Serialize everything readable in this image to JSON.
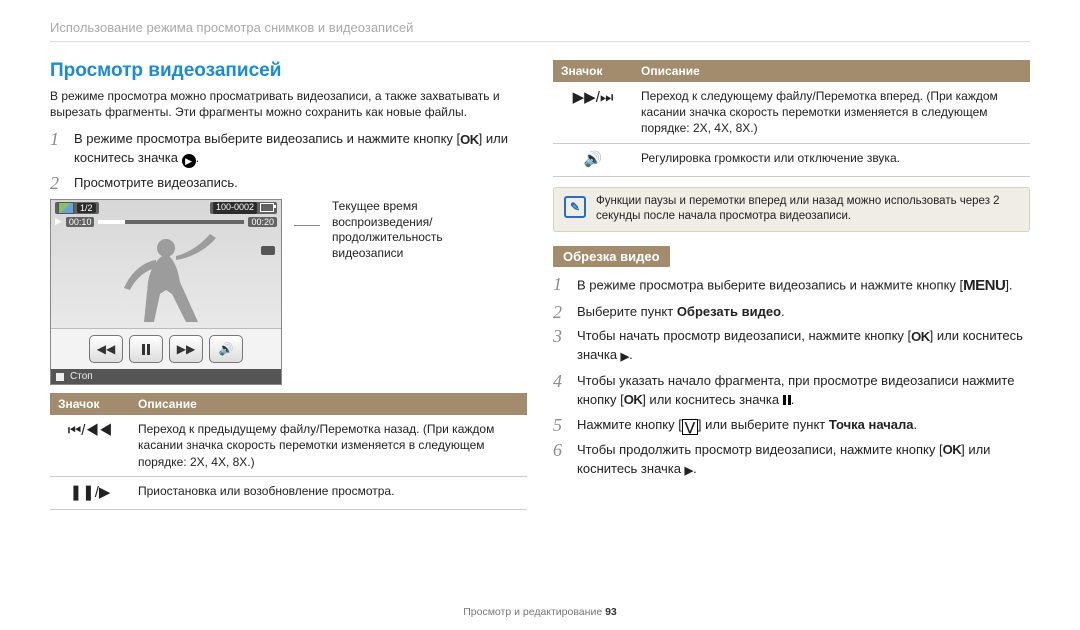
{
  "breadcrumb": "Использование режима просмотра снимков и видеозаписей",
  "section_title": "Просмотр видеозаписей",
  "intro": "В режиме просмотра можно просматривать видеозаписи, а также захватывать и вырезать фрагменты. Эти фрагменты можно сохранить как новые файлы.",
  "steps_left": {
    "s1_a": "В режиме просмотра выберите видеозапись и нажмите кнопку [",
    "s1_b": "] или коснитесь значка ",
    "s1_c": ".",
    "s2": "Просмотрите видеозапись."
  },
  "player": {
    "pic_count": "1/2",
    "file_label": "100-0002",
    "time_current": "00:10",
    "time_total": "00:20",
    "stop": "Стоп"
  },
  "player_caption": "Текущее время воспроизведения/продолжительность видеозаписи",
  "table_hdr_icon": "Значок",
  "table_hdr_desc": "Описание",
  "left_table": {
    "r1_icon": "⏮/◀◀",
    "r1_desc": "Переход к предыдущему файлу/Перемотка назад. (При каждом касании значка скорость перемотки изменяется в следующем порядке: 2X, 4X, 8X.)",
    "r2_icon": "❚❚/▶",
    "r2_desc": "Приостановка или возобновление просмотра."
  },
  "right_table": {
    "r1_icon": "▶▶/⏭",
    "r1_desc": "Переход к следующему файлу/Перемотка вперед. (При каждом касании значка скорость перемотки изменяется в следующем порядке: 2X, 4X, 8X.)",
    "r2_icon": "🔊",
    "r2_desc": "Регулировка громкости или отключение звука."
  },
  "note": "Функции паузы и перемотки вперед или назад можно использовать через 2 секунды после начала просмотра видеозаписи.",
  "subhead_trim": "Обрезка видео",
  "trim_steps": {
    "s1_a": "В режиме просмотра выберите видеозапись и нажмите кнопку [",
    "s1_b": "].",
    "s2_a": "Выберите пункт ",
    "s2_b": "Обрезать видео",
    "s2_c": ".",
    "s3_a": "Чтобы начать просмотр видеозаписи, нажмите кнопку [",
    "s3_b": "] или коснитесь значка ",
    "s3_c": ".",
    "s4_a": "Чтобы указать начало фрагмента, при просмотре видеозаписи нажмите кнопку [",
    "s4_b": "] или коснитесь значка ",
    "s4_c": ".",
    "s5_a": "Нажмите кнопку [",
    "s5_b": "] или выберите пункт ",
    "s5_c": "Точка начала",
    "s5_d": ".",
    "s6_a": "Чтобы продолжить просмотр видеозаписи, нажмите кнопку [",
    "s6_b": "] или коснитесь значка ",
    "s6_c": "."
  },
  "footer_section": "Просмотр и редактирование ",
  "footer_page": "93",
  "glyphs": {
    "ok": "OK",
    "menu": "MENU"
  }
}
